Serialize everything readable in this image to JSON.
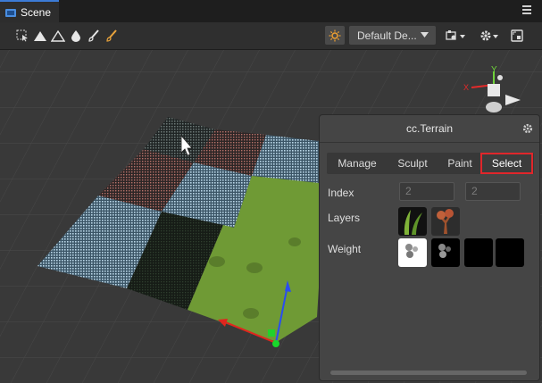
{
  "header": {
    "tab_label": "Scene"
  },
  "toolbar": {
    "camera_dropdown_label": "Default De...",
    "tool_icons": [
      "select-rect-icon",
      "terrain-raise-icon",
      "terrain-smooth-icon",
      "terrain-drop-icon",
      "brush-icon",
      "paint-brush-icon"
    ]
  },
  "terrain_panel": {
    "title": "cc.Terrain",
    "tabs": [
      "Manage",
      "Sculpt",
      "Paint",
      "Select"
    ],
    "selected_tab": "Select",
    "index_label": "Index",
    "index_values": [
      "2",
      "2"
    ],
    "layers_label": "Layers",
    "weight_label": "Weight"
  },
  "colors": {
    "accent": "#3c7bd6",
    "selected_outline": "#e0262b",
    "grass": "#6f9a35"
  }
}
